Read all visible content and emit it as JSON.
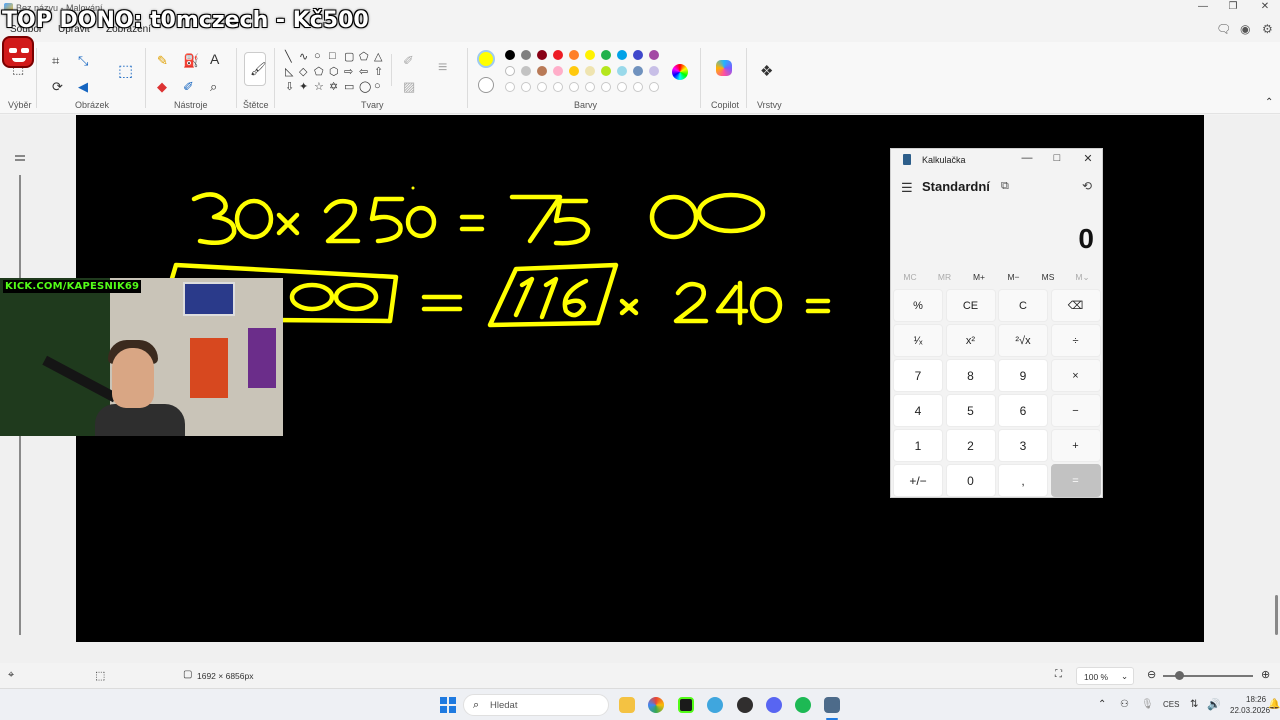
{
  "window": {
    "title": "Bez názvu - Malování",
    "minimize": "—",
    "maximize": "❐",
    "close": "✕"
  },
  "overlay": {
    "donor_text": "TOP DONO: t0mczech - Kč500",
    "kick_label": "KICK.COM/KAPESNIK69"
  },
  "menu": {
    "file": "Soubor",
    "edit": "Upravit",
    "view": "Zobrazení"
  },
  "ribbon": {
    "groups": {
      "selection": "Výběr",
      "image": "Obrázek",
      "tools": "Nástroje",
      "brushes": "Štětce",
      "shapes": "Tvary",
      "colors": "Barvy",
      "copilot": "Copilot",
      "layers": "Vrstvy"
    }
  },
  "colors": {
    "current": "#ffff00",
    "row1": [
      "#000000",
      "#7f7f7f",
      "#880015",
      "#ed1c24",
      "#ff7f27",
      "#fff200",
      "#22b14c",
      "#00a2e8",
      "#3f48cc",
      "#a349a4"
    ],
    "row2": [
      "#ffffff",
      "#c3c3c3",
      "#b97a57",
      "#ffaec9",
      "#ffc90e",
      "#efe4b0",
      "#b5e61d",
      "#99d9ea",
      "#7092be",
      "#c8bfe7"
    ]
  },
  "canvas": {
    "background": "#000000",
    "ink": "#ffff00"
  },
  "drawing": {
    "line1": {
      "left": "30",
      "op": "x",
      "right": "250",
      "eq": "=",
      "result": "7500"
    },
    "line2": {
      "boxed_left": "7500",
      "eq": "=",
      "boxed_mid": "116",
      "op": "x",
      "right": "240",
      "eq2": "="
    }
  },
  "calculator": {
    "title": "Kalkulačka",
    "mode": "Standardní",
    "display": "0",
    "memory": [
      "MC",
      "MR",
      "M+",
      "M−",
      "MS",
      "M⌄"
    ],
    "keys": [
      [
        "%",
        "CE",
        "C",
        "⌫"
      ],
      [
        "¹⁄ₓ",
        "x²",
        "²√x",
        "÷"
      ],
      [
        "7",
        "8",
        "9",
        "×"
      ],
      [
        "4",
        "5",
        "6",
        "−"
      ],
      [
        "1",
        "2",
        "3",
        "+"
      ],
      [
        "+/−",
        "0",
        ",",
        "="
      ]
    ]
  },
  "status": {
    "size": "1692 × 6856px",
    "zoom": "100 %"
  },
  "taskbar": {
    "search_placeholder": "Hledat",
    "lang": "CES",
    "time": "18:26",
    "date": "22.03.2026"
  }
}
